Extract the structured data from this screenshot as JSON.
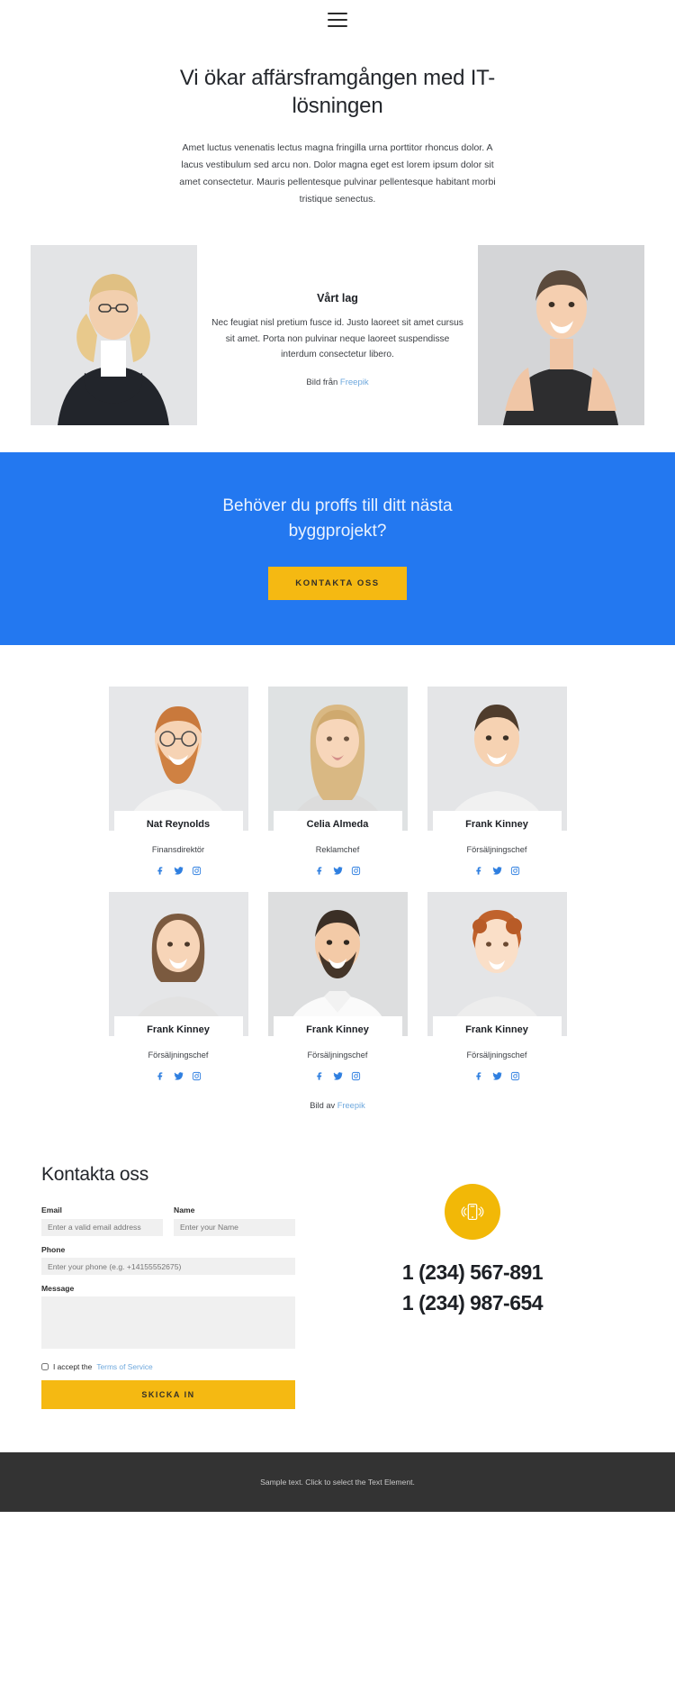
{
  "header": {
    "menu_icon": "hamburger-menu-icon"
  },
  "hero": {
    "title": "Vi ökar affärsframgången med IT-lösningen",
    "subtitle": "Amet luctus venenatis lectus magna fringilla urna porttitor rhoncus dolor. A lacus vestibulum sed arcu non. Dolor magna eget est lorem ipsum dolor sit amet consectetur. Mauris pellentesque pulvinar pellentesque habitant morbi tristique senectus."
  },
  "intro": {
    "heading": "Vårt lag",
    "paragraph": "Nec feugiat nisl pretium fusce id. Justo laoreet sit amet cursus sit amet. Porta non pulvinar neque laoreet suspendisse interdum consectetur libero.",
    "credit_prefix": "Bild från ",
    "credit_link": "Freepik"
  },
  "cta": {
    "title": "Behöver du proffs till ditt nästa byggprojekt?",
    "button": "KONTAKTA OSS",
    "background_color": "#2378f0",
    "button_color": "#f5b912"
  },
  "team": {
    "members": [
      {
        "name": "Nat Reynolds",
        "role": "Finansdirektör"
      },
      {
        "name": "Celia Almeda",
        "role": "Reklamchef"
      },
      {
        "name": "Frank Kinney",
        "role": "Försäljningschef"
      },
      {
        "name": "Frank Kinney",
        "role": "Försäljningschef"
      },
      {
        "name": "Frank Kinney",
        "role": "Försäljningschef"
      },
      {
        "name": "Frank Kinney",
        "role": "Försäljningschef"
      }
    ],
    "social_icons": [
      "facebook-icon",
      "twitter-icon",
      "instagram-icon"
    ],
    "credit_prefix": "Bild av ",
    "credit_link": "Freepik"
  },
  "contact": {
    "heading": "Kontakta oss",
    "email_label": "Email",
    "email_placeholder": "Enter a valid email address",
    "name_label": "Name",
    "name_placeholder": "Enter your Name",
    "phone_label": "Phone",
    "phone_placeholder": "Enter your phone (e.g. +14155552675)",
    "message_label": "Message",
    "message_placeholder": "",
    "terms_text": "I accept the ",
    "terms_link": "Terms of Service",
    "submit": "SKICKA IN",
    "phone_icon": "mobile-phone-ringing-icon",
    "phone_number_1": "1 (234) 567-891",
    "phone_number_2": "1 (234) 987-654"
  },
  "footer": {
    "text": "Sample text. Click to select the Text Element."
  }
}
